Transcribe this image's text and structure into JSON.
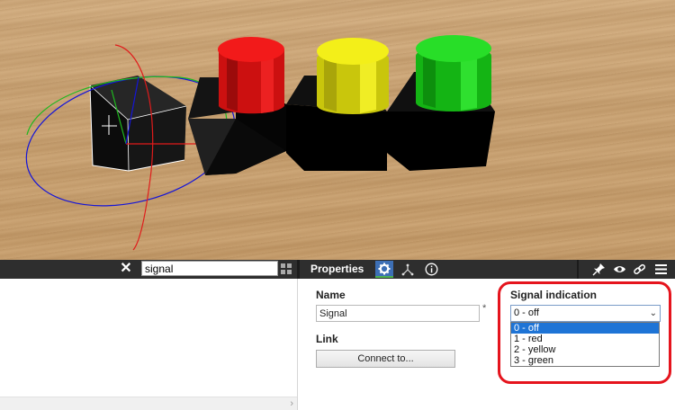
{
  "left_panel": {
    "search_value": "signal"
  },
  "properties": {
    "title": "Properties",
    "tabs": [
      {
        "icon": "gear-icon",
        "active": true
      },
      {
        "icon": "hierarchy-icon",
        "active": false
      },
      {
        "icon": "info-icon",
        "active": false
      }
    ],
    "tools": [
      "pin-icon",
      "eye-icon",
      "link-icon",
      "menu-icon"
    ],
    "name_label": "Name",
    "name_value": "Signal",
    "required_marker": "*",
    "link_label": "Link",
    "connect_label": "Connect to...",
    "signal_label": "Signal indication",
    "signal_selected": "0 - off",
    "signal_options": [
      "0 - off",
      "1 - red",
      "2 - yellow",
      "3 - green"
    ]
  },
  "colors": {
    "toolbar": "#2e2e2e",
    "accent": "#3d6fb5",
    "highlight": "#e5141d",
    "lamp_red": "#e21212",
    "lamp_yellow": "#e2df12",
    "lamp_green": "#18c418"
  }
}
